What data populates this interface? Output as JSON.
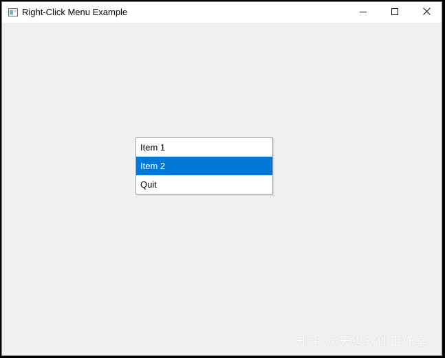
{
  "window": {
    "title": "Right-Click Menu Example",
    "icon": "app-window-icon",
    "controls": {
      "minimize_icon": "minimize-icon",
      "maximize_icon": "maximize-icon",
      "close_icon": "close-icon"
    }
  },
  "context_menu": {
    "items": [
      {
        "label": "Item 1",
        "selected": false
      },
      {
        "label": "Item 2",
        "selected": true
      },
      {
        "label": "Quit",
        "selected": false
      }
    ]
  },
  "watermark": {
    "text": "知乎 @天恩软件工作室"
  },
  "colors": {
    "selection": "#0078d7",
    "client_background": "#f0f0f0",
    "titlebar_background": "#ffffff"
  }
}
